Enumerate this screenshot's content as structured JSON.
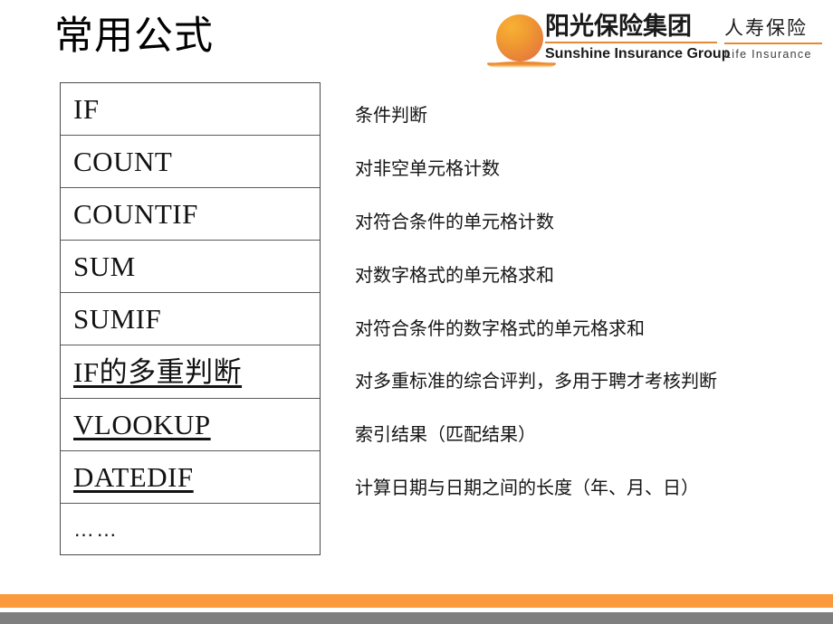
{
  "slide": {
    "title": "常用公式"
  },
  "logo": {
    "sun_icon": "sun-icon",
    "primary_cn": "阳光保险集团",
    "primary_en": "Sunshine Insurance Group",
    "secondary_cn": "人寿保险",
    "secondary_en": "Life Insurance",
    "accent_color": "#e58a33",
    "sun_color_light": "#f8b133",
    "sun_color_dark": "#e0743d"
  },
  "formula_table": {
    "rows": [
      {
        "name": "IF",
        "is_link": false,
        "is_dots": false
      },
      {
        "name": "COUNT",
        "is_link": false,
        "is_dots": false
      },
      {
        "name": "COUNTIF",
        "is_link": false,
        "is_dots": false
      },
      {
        "name": "SUM",
        "is_link": false,
        "is_dots": false
      },
      {
        "name": "SUMIF",
        "is_link": false,
        "is_dots": false
      },
      {
        "name": "IF的多重判断",
        "is_link": true,
        "is_dots": false
      },
      {
        "name": "VLOOKUP",
        "is_link": true,
        "is_dots": false
      },
      {
        "name": "DATEDIF",
        "is_link": true,
        "is_dots": false
      },
      {
        "name": "……",
        "is_link": false,
        "is_dots": true
      }
    ]
  },
  "descriptions": {
    "items": [
      "条件判断",
      "对非空单元格计数",
      "对符合条件的单元格计数",
      "对数字格式的单元格求和",
      "对符合条件的数字格式的单元格求和",
      "对多重标准的综合评判，多用于聘才考核判断",
      "索引结果（匹配结果）",
      "计算日期与日期之间的长度（年、月、日）"
    ]
  },
  "footer": {
    "bar_orange_color": "#fb9a3c",
    "bar_gray_color": "#7f7f7f"
  }
}
